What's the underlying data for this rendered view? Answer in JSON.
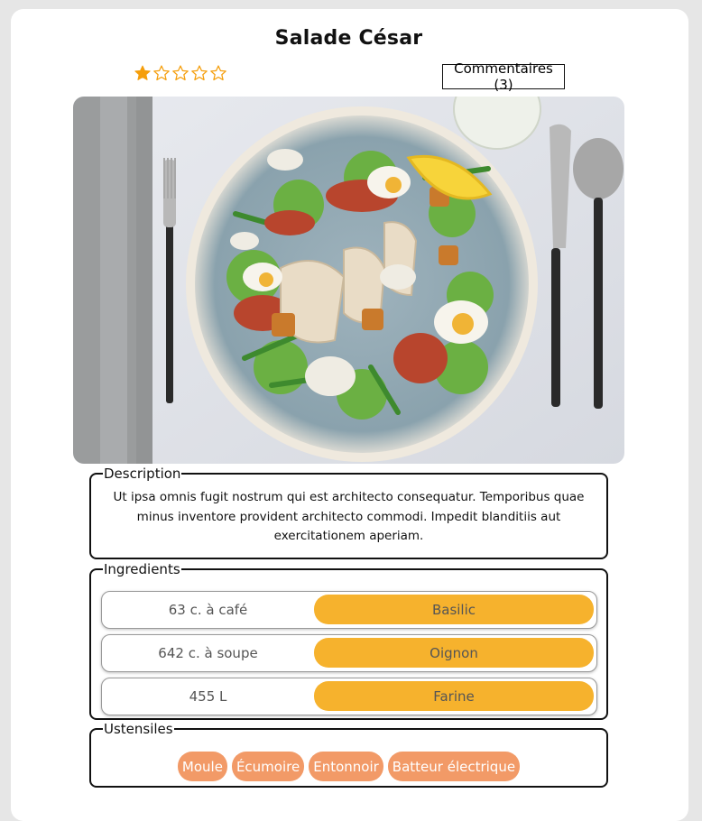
{
  "recipe": {
    "title": "Salade César",
    "rating": 1,
    "rating_max": 5,
    "comments_label": "Commentaires (3)"
  },
  "image": {
    "description_icon": "salad-photo"
  },
  "description": {
    "legend": "Description",
    "text": "Ut ipsa omnis fugit nostrum qui est architecto consequatur. Temporibus quae minus inventore provident architecto commodi. Impedit blanditiis aut exercitationem aperiam."
  },
  "ingredients": {
    "legend": "Ingredients",
    "items": [
      {
        "quantity": "63 c. à café",
        "name": "Basilic"
      },
      {
        "quantity": "642 c. à soupe",
        "name": "Oignon"
      },
      {
        "quantity": "455 L",
        "name": "Farine"
      }
    ]
  },
  "utensils": {
    "legend": "Ustensiles",
    "items": [
      "Moule",
      "Écumoire",
      "Entonnoir",
      "Batteur électrique"
    ]
  },
  "colors": {
    "star": "#f59e0b",
    "ingredient_pill": "#f6b22d",
    "utensil_pill": "#f29a67"
  }
}
